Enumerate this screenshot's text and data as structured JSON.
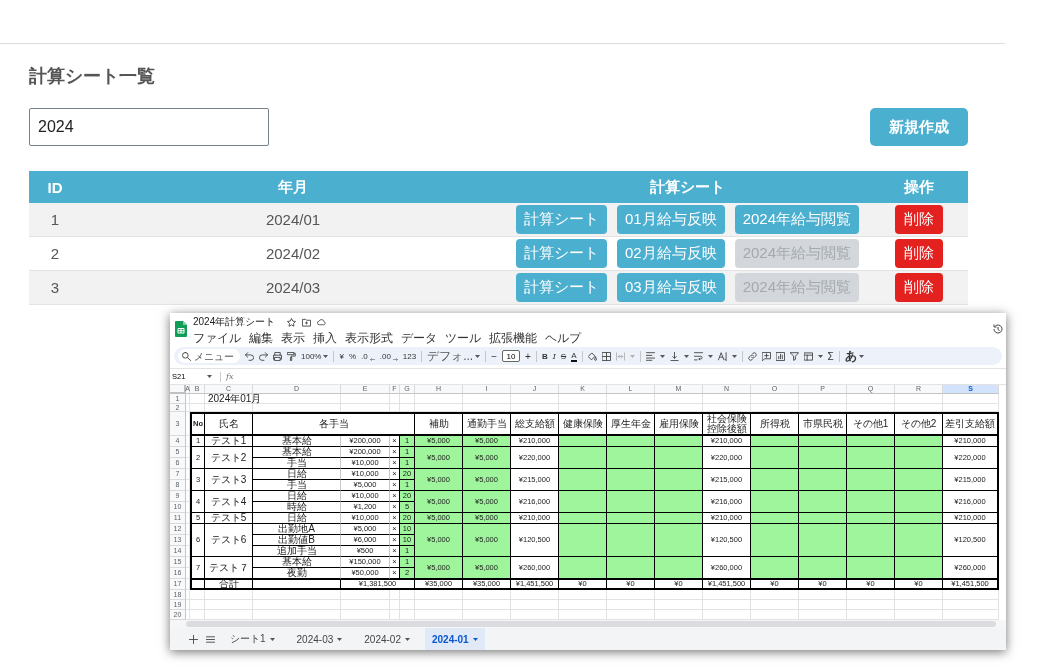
{
  "page_title": "計算シート一覧",
  "search": {
    "value": "2024"
  },
  "create_button": {
    "label": "新規作成"
  },
  "table": {
    "columns": [
      "ID",
      "年月",
      "計算シート",
      "操作"
    ],
    "rows": [
      {
        "id": "1",
        "month": "2024/01",
        "actions": [
          {
            "label": "計算シート",
            "disabled": false
          },
          {
            "label": "01月給与反映",
            "disabled": false
          },
          {
            "label": "2024年給与閲覧",
            "disabled": false
          }
        ],
        "delete": {
          "label": "削除"
        }
      },
      {
        "id": "2",
        "month": "2024/02",
        "actions": [
          {
            "label": "計算シート",
            "disabled": false
          },
          {
            "label": "02月給与反映",
            "disabled": false
          },
          {
            "label": "2024年給与閲覧",
            "disabled": true
          }
        ],
        "delete": {
          "label": "削除"
        }
      },
      {
        "id": "3",
        "month": "2024/03",
        "actions": [
          {
            "label": "計算シート",
            "disabled": false
          },
          {
            "label": "03月給与反映",
            "disabled": false
          },
          {
            "label": "2024年給与閲覧",
            "disabled": true
          }
        ],
        "delete": {
          "label": "削除"
        }
      }
    ]
  },
  "spreadsheet_window": {
    "title": "2024年計算シート",
    "menu": [
      "ファイル",
      "編集",
      "表示",
      "挿入",
      "表示形式",
      "データ",
      "ツール",
      "拡張機能",
      "ヘルプ"
    ],
    "toolbar": {
      "search_placeholder": "メニュー",
      "zoom": "100%",
      "currency": "¥",
      "percent": "%",
      "decrease_decimal": ".0",
      "increase_decimal": ".00",
      "number_format": "123",
      "font": "デフォ...",
      "font_size_minus": "−",
      "font_size": "10",
      "font_size_plus": "+",
      "bold": "B",
      "italic": "I",
      "strikethrough": "S",
      "text_color": "A",
      "functions": "Σ",
      "input_tools": "あ"
    },
    "formula_bar": {
      "name_box": "S21",
      "function_label": "fx"
    },
    "columns": [
      {
        "label": "A",
        "selected": false
      },
      {
        "label": "B",
        "selected": false
      },
      {
        "label": "C",
        "selected": false
      },
      {
        "label": "D",
        "selected": false
      },
      {
        "label": "E",
        "selected": false
      },
      {
        "label": "F",
        "selected": false
      },
      {
        "label": "G",
        "selected": false
      },
      {
        "label": "H",
        "selected": false
      },
      {
        "label": "I",
        "selected": false
      },
      {
        "label": "J",
        "selected": false
      },
      {
        "label": "K",
        "selected": false
      },
      {
        "label": "L",
        "selected": false
      },
      {
        "label": "M",
        "selected": false
      },
      {
        "label": "N",
        "selected": false
      },
      {
        "label": "O",
        "selected": false
      },
      {
        "label": "P",
        "selected": false
      },
      {
        "label": "Q",
        "selected": false
      },
      {
        "label": "R",
        "selected": false
      },
      {
        "label": "S",
        "selected": true
      }
    ],
    "row_numbers": [
      "1",
      "2",
      "3",
      "4",
      "5",
      "6",
      "7",
      "8",
      "9",
      "10",
      "11",
      "12",
      "13",
      "14",
      "15",
      "16",
      "17",
      "18",
      "19",
      "20"
    ],
    "sheet": {
      "title_cell": "2024年01月",
      "header": [
        "No",
        "氏名",
        "各手当",
        "補助",
        "通勤手当",
        "総支給額",
        "健康保険",
        "厚生年金",
        "雇用保険",
        "社会保険控除後額",
        "所得税",
        "市県民税",
        "その他1",
        "その他2",
        "差引支給額"
      ],
      "employees": [
        {
          "no": "1",
          "name": "テスト1",
          "allowances": [
            {
              "label": "基本給",
              "amount": "¥200,000",
              "operator": "×",
              "quantity": "1"
            }
          ],
          "subsidy": "¥5,000",
          "commute": "¥5,000",
          "gross": "¥210,000",
          "after_social": "¥210,000",
          "net": "¥210,000"
        },
        {
          "no": "2",
          "name": "テスト2",
          "allowances": [
            {
              "label": "基本給",
              "amount": "¥200,000",
              "operator": "×",
              "quantity": "1"
            },
            {
              "label": "手当",
              "amount": "¥10,000",
              "operator": "×",
              "quantity": "1"
            }
          ],
          "subsidy": "¥5,000",
          "commute": "¥5,000",
          "gross": "¥220,000",
          "after_social": "¥220,000",
          "net": "¥220,000"
        },
        {
          "no": "3",
          "name": "テスト3",
          "allowances": [
            {
              "label": "日給",
              "amount": "¥10,000",
              "operator": "×",
              "quantity": "20"
            },
            {
              "label": "手当",
              "amount": "¥5,000",
              "operator": "×",
              "quantity": "1"
            }
          ],
          "subsidy": "¥5,000",
          "commute": "¥5,000",
          "gross": "¥215,000",
          "after_social": "¥215,000",
          "net": "¥215,000"
        },
        {
          "no": "4",
          "name": "テスト4",
          "allowances": [
            {
              "label": "日給",
              "amount": "¥10,000",
              "operator": "×",
              "quantity": "20"
            },
            {
              "label": "時給",
              "amount": "¥1,200",
              "operator": "×",
              "quantity": "5"
            }
          ],
          "subsidy": "¥5,000",
          "commute": "¥5,000",
          "gross": "¥216,000",
          "after_social": "¥216,000",
          "net": "¥216,000"
        },
        {
          "no": "5",
          "name": "テスト5",
          "allowances": [
            {
              "label": "日給",
              "amount": "¥10,000",
              "operator": "×",
              "quantity": "20"
            }
          ],
          "subsidy": "¥5,000",
          "commute": "¥5,000",
          "gross": "¥210,000",
          "after_social": "¥210,000",
          "net": "¥210,000"
        },
        {
          "no": "6",
          "name": "テスト6",
          "allowances": [
            {
              "label": "出勤地A",
              "amount": "¥5,000",
              "operator": "×",
              "quantity": "10"
            },
            {
              "label": "出勤値B",
              "amount": "¥6,000",
              "operator": "×",
              "quantity": "10"
            },
            {
              "label": "追加手当",
              "amount": "¥500",
              "operator": "×",
              "quantity": "1"
            }
          ],
          "subsidy": "¥5,000",
          "commute": "¥5,000",
          "gross": "¥120,500",
          "after_social": "¥120,500",
          "net": "¥120,500"
        },
        {
          "no": "7",
          "name": "テスト７",
          "allowances": [
            {
              "label": "基本給",
              "amount": "¥150,000",
              "operator": "×",
              "quantity": "1"
            },
            {
              "label": "夜勤",
              "amount": "¥50,000",
              "operator": "×",
              "quantity": "2"
            }
          ],
          "subsidy": "¥5,000",
          "commute": "¥5,000",
          "gross": "¥260,000",
          "after_social": "¥260,000",
          "net": "¥260,000"
        }
      ],
      "total": {
        "label": "合計",
        "allowance_total": "¥1,381,500",
        "values": [
          "¥35,000",
          "¥35,000",
          "¥1,451,500",
          "¥0",
          "¥0",
          "¥0",
          "¥1,451,500",
          "¥0",
          "¥0",
          "¥0",
          "¥0",
          "¥1,451,500"
        ]
      }
    },
    "sheet_tabs": [
      {
        "label": "シート1",
        "selected": false
      },
      {
        "label": "2024-03",
        "selected": false
      },
      {
        "label": "2024-02",
        "selected": false
      },
      {
        "label": "2024-01",
        "selected": true
      }
    ]
  }
}
